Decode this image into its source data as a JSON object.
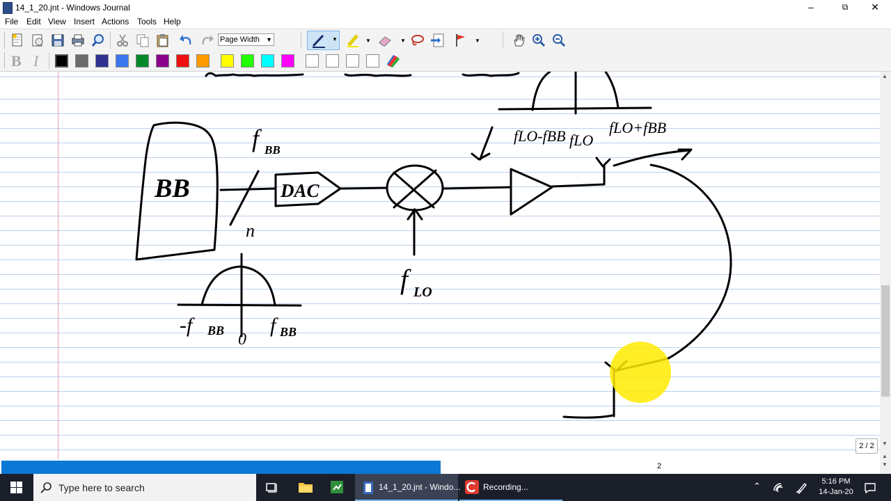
{
  "window": {
    "title": "14_1_20.jnt - Windows Journal",
    "minimize": "–",
    "maximize": "⧉",
    "close": "✕"
  },
  "menu": {
    "items": [
      "File",
      "Edit",
      "View",
      "Insert",
      "Actions",
      "Tools",
      "Help"
    ]
  },
  "toolbar": {
    "zoom_value": "Page Width"
  },
  "colors": {
    "swatches": [
      "#000000",
      "#6b6b6b",
      "#2e3192",
      "#3b78f0",
      "#00882b",
      "#8b008b",
      "#ee1111",
      "#ff9a00",
      "#ffff00",
      "#22ff00",
      "#00ffff",
      "#ff00ff",
      "#ffffff",
      "#ffffff",
      "#ffffff",
      "#ffffff"
    ],
    "ink": "#000000",
    "highlight": "#ffeb00"
  },
  "sketch": {
    "labels": {
      "bb_block": "BB",
      "f_bb_top": "f",
      "f_bb_top_sub": "BB",
      "n": "n",
      "dac": "DAC",
      "f_lo": "f",
      "f_lo_sub": "LO",
      "neg_fbb": "-f",
      "neg_fbb_sub": "BB",
      "zero": "0",
      "pos_fbb": "f",
      "pos_fbb_sub": "BB",
      "f_lo_minus": "fLO-fBB",
      "f_lo_mid": "fLO",
      "f_lo_plus": "fLO+fBB"
    }
  },
  "status": {
    "page_indicator": "2 / 2",
    "page_number": "2"
  },
  "taskbar": {
    "search_placeholder": "Type here to search",
    "journal_label": "14_1_20.jnt - Windo...",
    "recording_label": "Recording...",
    "time": "5:16 PM",
    "date": "14-Jan-20"
  }
}
